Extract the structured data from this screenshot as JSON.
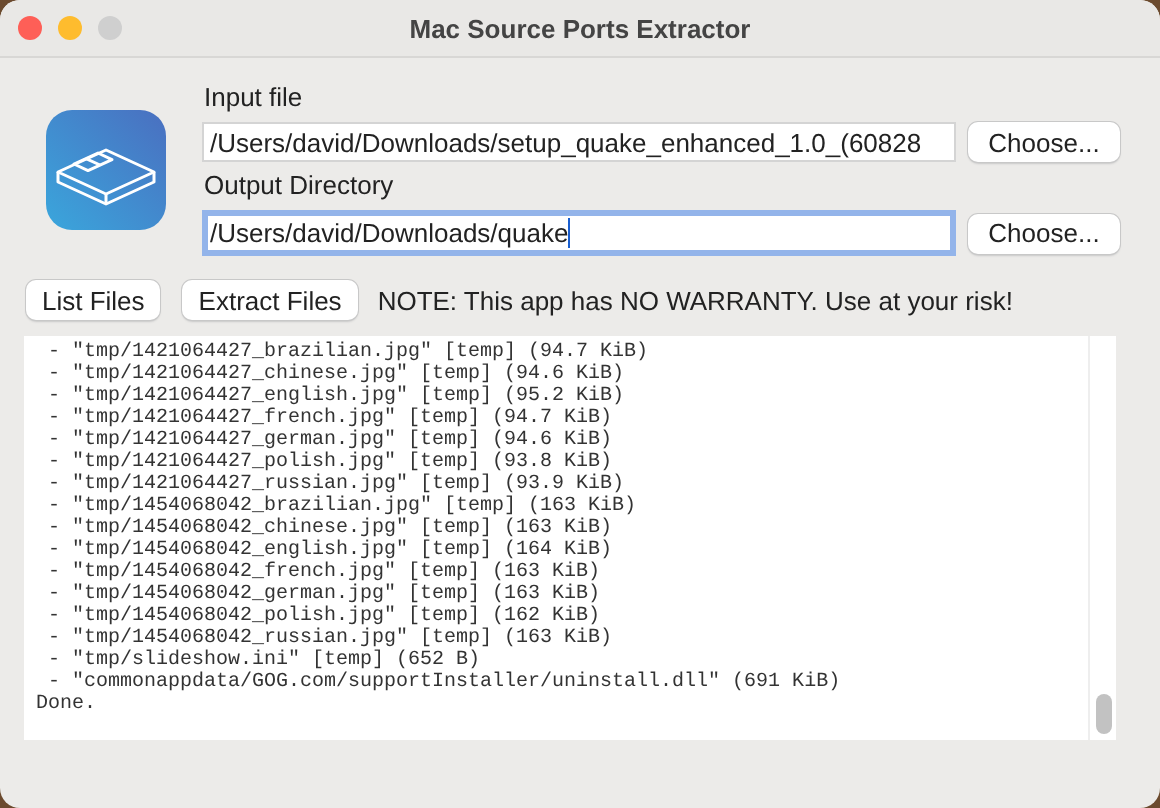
{
  "window": {
    "title": "Mac Source Ports Extractor"
  },
  "input_file": {
    "label": "Input file",
    "value": "/Users/david/Downloads/setup_quake_enhanced_1.0_(60828",
    "focused": false,
    "button": "Choose..."
  },
  "output_directory": {
    "label": "Output Directory",
    "value": "/Users/david/Downloads/quake",
    "focused": true,
    "button": "Choose..."
  },
  "actions": [
    "List Files",
    "Extract Files"
  ],
  "note": "NOTE: This app has NO WARRANTY. Use at your risk!",
  "log": [
    " - \"tmp/1421064427_brazilian.jpg\" [temp] (94.7 KiB)",
    " - \"tmp/1421064427_chinese.jpg\" [temp] (94.6 KiB)",
    " - \"tmp/1421064427_english.jpg\" [temp] (95.2 KiB)",
    " - \"tmp/1421064427_french.jpg\" [temp] (94.7 KiB)",
    " - \"tmp/1421064427_german.jpg\" [temp] (94.6 KiB)",
    " - \"tmp/1421064427_polish.jpg\" [temp] (93.8 KiB)",
    " - \"tmp/1421064427_russian.jpg\" [temp] (93.9 KiB)",
    " - \"tmp/1454068042_brazilian.jpg\" [temp] (163 KiB)",
    " - \"tmp/1454068042_chinese.jpg\" [temp] (163 KiB)",
    " - \"tmp/1454068042_english.jpg\" [temp] (164 KiB)",
    " - \"tmp/1454068042_french.jpg\" [temp] (163 KiB)",
    " - \"tmp/1454068042_german.jpg\" [temp] (163 KiB)",
    " - \"tmp/1454068042_polish.jpg\" [temp] (162 KiB)",
    " - \"tmp/1454068042_russian.jpg\" [temp] (163 KiB)",
    " - \"tmp/slideshow.ini\" [temp] (652 B)",
    " - \"commonappdata/GOG.com/supportInstaller/uninstall.dll\" (691 KiB)",
    "Done."
  ]
}
